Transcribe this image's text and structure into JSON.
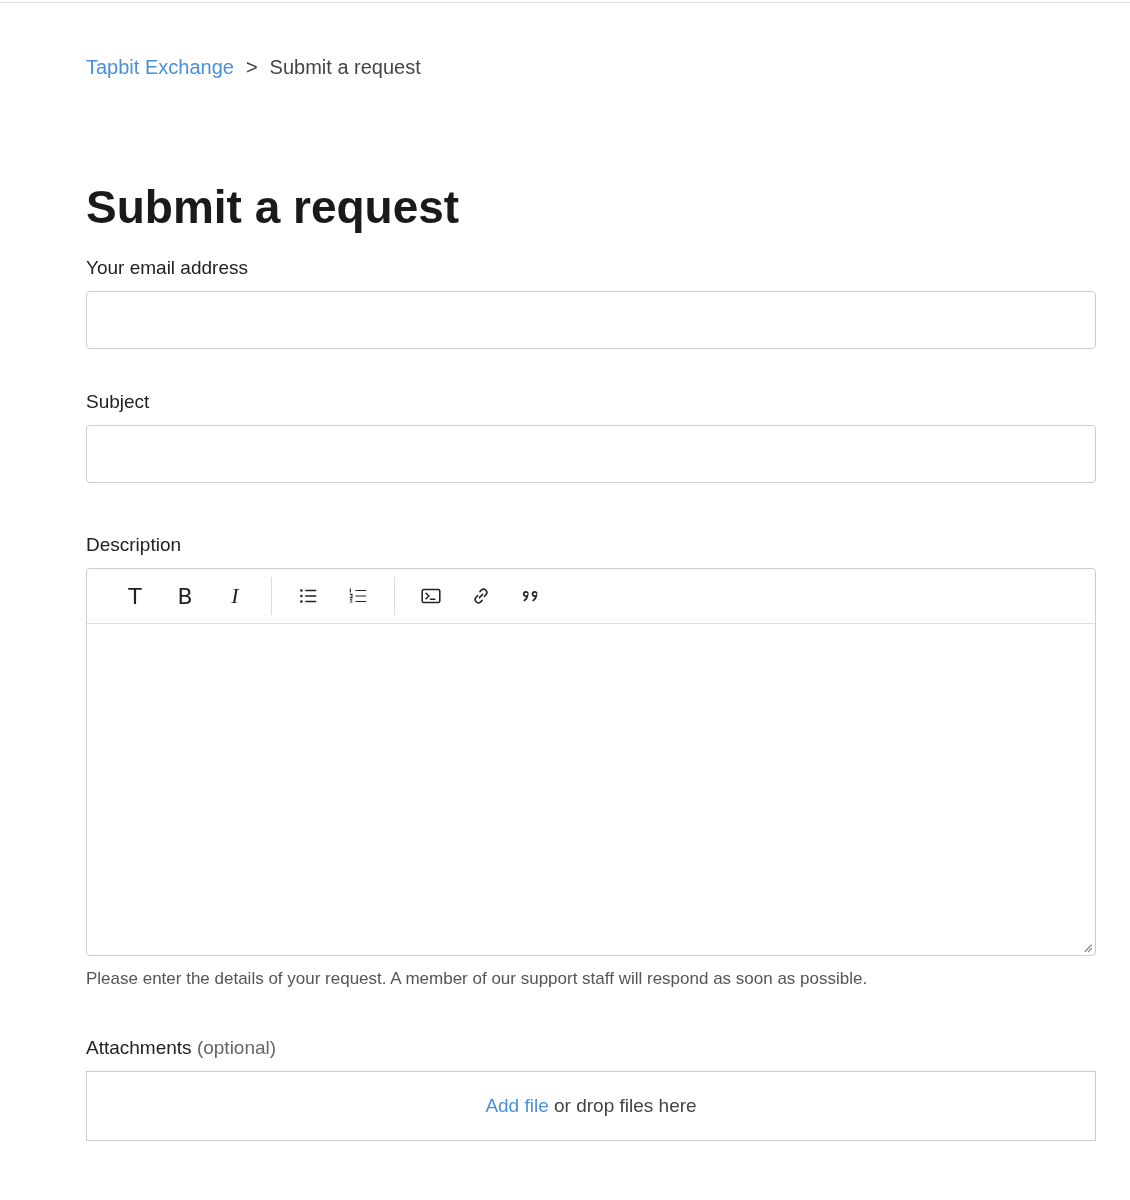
{
  "breadcrumb": {
    "link": "Tapbit Exchange",
    "separator": ">",
    "current": "Submit a request"
  },
  "title": "Submit a request",
  "fields": [
    {
      "label": "Your email address"
    },
    {
      "label": "Subject"
    }
  ],
  "description": {
    "label": "Description",
    "toolbar": [
      [
        {
          "kind": "text",
          "label": "T"
        },
        {
          "kind": "bold",
          "label": "B"
        },
        {
          "kind": "italic",
          "label": "I"
        }
      ],
      [
        {
          "kind": "bullet-list"
        },
        {
          "kind": "numbered-list"
        }
      ],
      [
        {
          "kind": "code"
        },
        {
          "kind": "link"
        },
        {
          "kind": "quote"
        }
      ]
    ],
    "hint": "Please enter the details of your request. A member of our support staff will respond as soon as possible."
  },
  "attachments": {
    "label": "Attachments",
    "optional": "(optional)",
    "link": "Add file",
    "rest": "or drop files here"
  }
}
